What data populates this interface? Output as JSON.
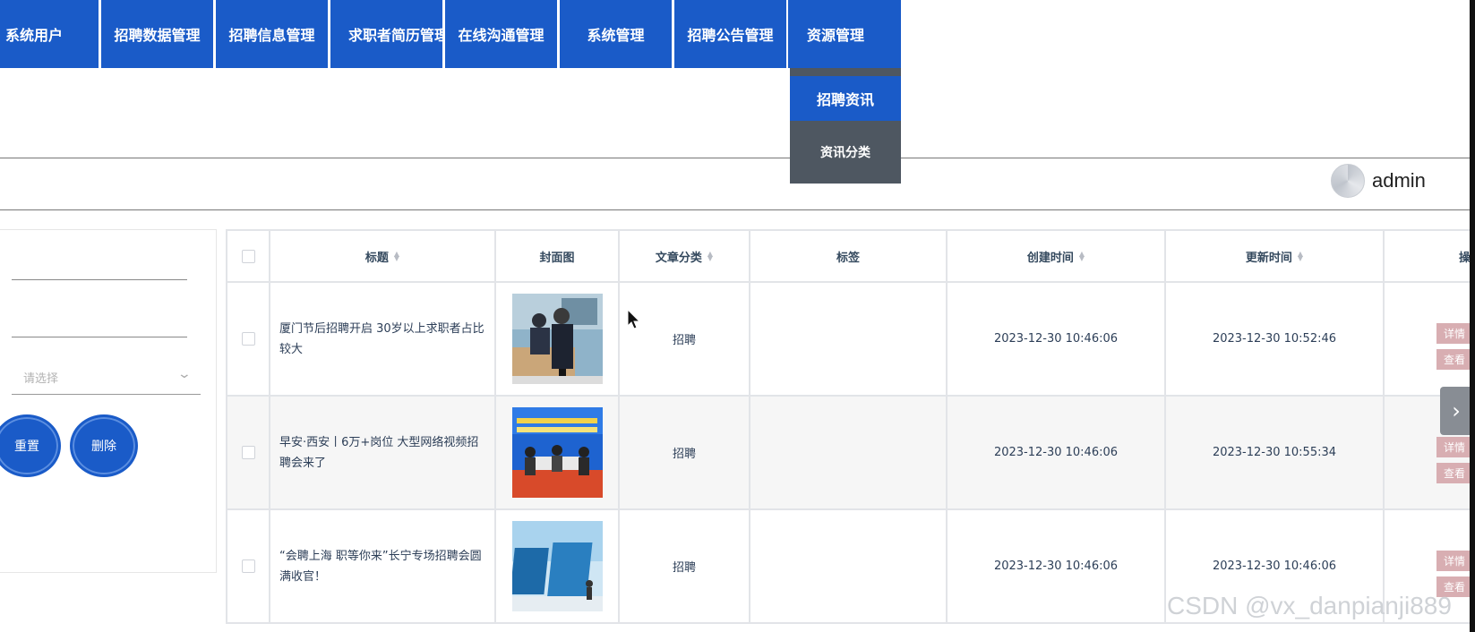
{
  "nav": {
    "items": [
      "系统用户",
      "招聘数据管理",
      "招聘信息管理",
      "求职者简历管理",
      "在线沟通管理",
      "系统管理",
      "招聘公告管理",
      "资源管理"
    ],
    "submenu": [
      "招聘资讯",
      "资讯分类"
    ]
  },
  "user": {
    "name": "admin"
  },
  "search": {
    "select_placeholder": "请选择",
    "reset_label": "重置",
    "delete_label": "删除"
  },
  "table": {
    "headers": [
      "标题",
      "封面图",
      "文章分类",
      "标签",
      "创建时间",
      "更新时间",
      "操"
    ],
    "rows": [
      {
        "title": "厦门节后招聘开启 30岁以上求职者占比较大",
        "category": "招聘",
        "tag": "",
        "created": "2023-12-30 10:46:06",
        "updated": "2023-12-30 10:52:46",
        "actions": [
          "详情",
          "查看"
        ]
      },
      {
        "title": "早安·西安丨6万+岗位 大型网络视频招聘会来了",
        "category": "招聘",
        "tag": "",
        "created": "2023-12-30 10:46:06",
        "updated": "2023-12-30 10:55:34",
        "actions": [
          "详情",
          "查看"
        ]
      },
      {
        "title": "“会聘上海 职等你来”长宁专场招聘会圆满收官！",
        "category": "招聘",
        "tag": "",
        "created": "2023-12-30 10:46:06",
        "updated": "2023-12-30 10:46:06",
        "actions": [
          "详情",
          "查看"
        ]
      }
    ]
  },
  "watermark": "CSDN @vx_danpianji889",
  "colors": {
    "primary": "#1a5bc8",
    "submenu_bg": "#4e5761",
    "action_btn": "#d8aeb2"
  }
}
